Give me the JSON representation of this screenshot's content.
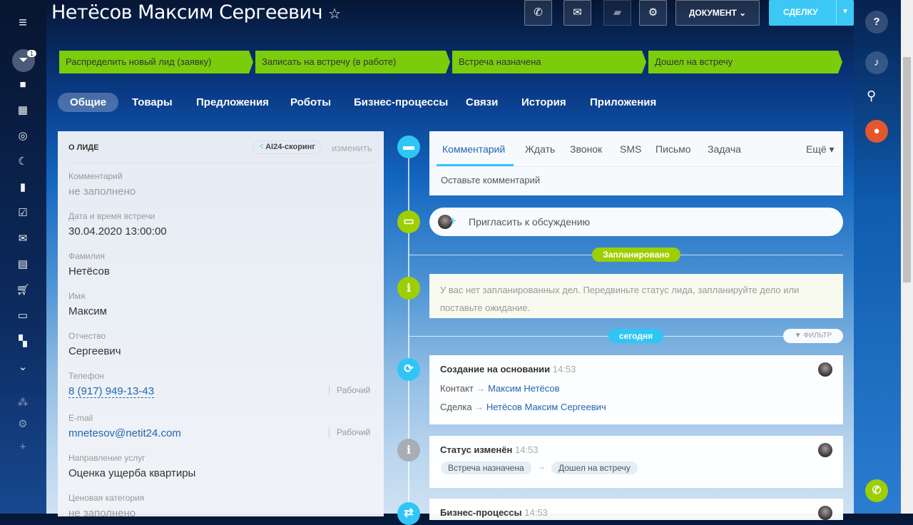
{
  "header": {
    "title": "Нетёсов Максим Сергеевич",
    "document_label": "ДОКУМЕНТ",
    "deal_label": "СДЕЛКУ"
  },
  "sidebar": {
    "badge": "1"
  },
  "stages": [
    "Распределить новый лид (заявку)",
    "Записать на встречу (в работе)",
    "Встреча назначена",
    "Дошел на встречу"
  ],
  "tabs": [
    "Общие",
    "Товары",
    "Предложения",
    "Роботы",
    "Бизнес-процессы",
    "Связи",
    "История",
    "Приложения"
  ],
  "lead": {
    "section_title": "О ЛИДЕ",
    "scoring_label": "AI24-скоринг",
    "edit_label": "изменить",
    "fields": [
      {
        "label": "Комментарий",
        "value": "не заполнено"
      },
      {
        "label": "Дата и время встречи",
        "value": "30.04.2020 13:00:00"
      },
      {
        "label": "Фамилия",
        "value": "Нетёсов"
      },
      {
        "label": "Имя",
        "value": "Максим"
      },
      {
        "label": "Отчество",
        "value": "Сергеевич"
      },
      {
        "label": "Телефон",
        "value": "8 (917) 949-13-43",
        "type": "Рабочий"
      },
      {
        "label": "E-mail",
        "value": "mnetesov@netit24.com",
        "type": "Рабочий"
      },
      {
        "label": "Направление услуг",
        "value": "Оценка ущерба квартиры"
      },
      {
        "label": "Ценовая категория",
        "value": "не заполнено"
      }
    ]
  },
  "composer": {
    "tabs": [
      "Комментарий",
      "Ждать",
      "Звонок",
      "SMS",
      "Письмо",
      "Задача"
    ],
    "more": "Ещё",
    "placeholder": "Оставьте комментарий"
  },
  "invite": "Пригласить к обсуждению",
  "planned": {
    "label": "Запланировано",
    "text": "У вас нет запланированных дел. Передвиньте статус лида, запланируйте дело или поставьте ожидание."
  },
  "today": {
    "label": "сегодня",
    "filter": "ФИЛЬТР"
  },
  "events": [
    {
      "title": "Создание на основании",
      "time": "14:53",
      "rows": [
        {
          "k": "Контакт",
          "v": "Максим Нетёсов"
        },
        {
          "k": "Сделка",
          "v": "Нетёсов Максим Сергеевич"
        }
      ]
    },
    {
      "title": "Статус изменён",
      "time": "14:53",
      "from": "Встреча назначена",
      "to": "Дошел на встречу"
    },
    {
      "title": "Бизнес-процессы",
      "time": "14:53"
    }
  ],
  "colors": {
    "stage": "#7bcd0b",
    "accent": "#2fc6f6",
    "link": "#2067b0"
  }
}
